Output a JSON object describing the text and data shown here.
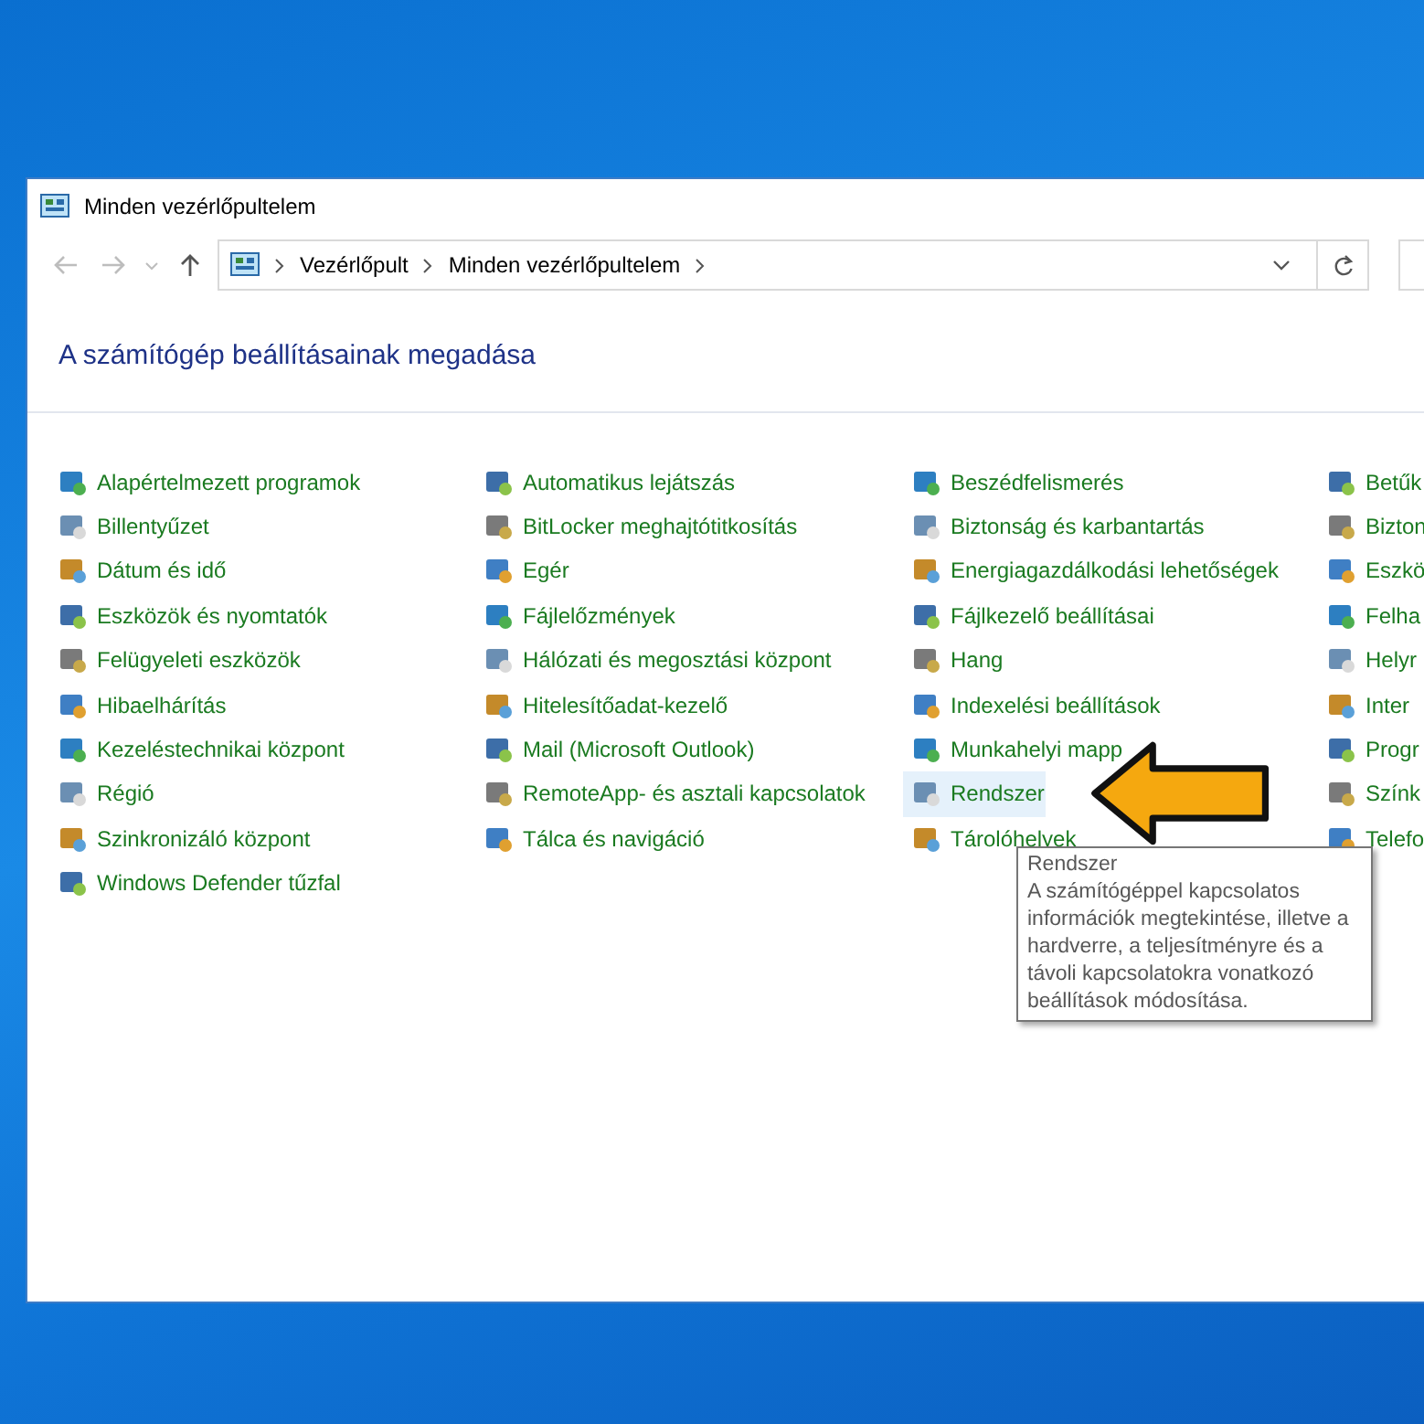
{
  "window": {
    "title": "Minden vezérlőpultelem"
  },
  "navigation": {
    "breadcrumbs": [
      "Vezérlőpult",
      "Minden vezérlőpultelem"
    ]
  },
  "heading": "A számítógép beállításainak megadása",
  "columns": [
    {
      "items": [
        {
          "label": "Alapértelmezett programok",
          "selected": false
        },
        {
          "label": "Billentyűzet",
          "selected": false
        },
        {
          "label": "Dátum és idő",
          "selected": false
        },
        {
          "label": "Eszközök és nyomtatók",
          "selected": false
        },
        {
          "label": "Felügyeleti eszközök",
          "selected": false
        },
        {
          "label": "Hibaelhárítás",
          "selected": false
        },
        {
          "label": "Kezeléstechnikai központ",
          "selected": false
        },
        {
          "label": "Régió",
          "selected": false
        },
        {
          "label": "Szinkronizáló központ",
          "selected": false
        },
        {
          "label": "Windows Defender tűzfal",
          "selected": false
        }
      ]
    },
    {
      "items": [
        {
          "label": "Automatikus lejátszás",
          "selected": false
        },
        {
          "label": "BitLocker meghajtótitkosítás",
          "selected": false
        },
        {
          "label": "Egér",
          "selected": false
        },
        {
          "label": "Fájlelőzmények",
          "selected": false
        },
        {
          "label": "Hálózati és megosztási központ",
          "selected": false
        },
        {
          "label": "Hitelesítőadat-kezelő",
          "selected": false
        },
        {
          "label": "Mail (Microsoft Outlook)",
          "selected": false
        },
        {
          "label": "RemoteApp- és asztali kapcsolatok",
          "selected": false
        },
        {
          "label": "Tálca és navigáció",
          "selected": false
        }
      ]
    },
    {
      "items": [
        {
          "label": "Beszédfelismerés",
          "selected": false
        },
        {
          "label": "Biztonság és karbantartás",
          "selected": false
        },
        {
          "label": "Energiagazdálkodási lehetőségek",
          "selected": false
        },
        {
          "label": "Fájlkezelő beállításai",
          "selected": false
        },
        {
          "label": "Hang",
          "selected": false
        },
        {
          "label": "Indexelési beállítások",
          "selected": false
        },
        {
          "label": "Munkahelyi mapp",
          "selected": false
        },
        {
          "label": "Rendszer",
          "selected": true
        },
        {
          "label": "Tárolóhelyek",
          "selected": false
        }
      ]
    },
    {
      "items": [
        {
          "label": "Betűk",
          "selected": false
        },
        {
          "label": "Bizton",
          "selected": false
        },
        {
          "label": "Eszkö",
          "selected": false
        },
        {
          "label": "Felha",
          "selected": false
        },
        {
          "label": "Helyr",
          "selected": false
        },
        {
          "label": "Inter",
          "selected": false
        },
        {
          "label": "Progr",
          "selected": false
        },
        {
          "label": "Színk",
          "selected": false
        },
        {
          "label": "Telefo",
          "selected": false
        }
      ]
    }
  ],
  "tooltip": {
    "title": "Rendszer",
    "text": "A számítógéppel kapcsolatos információk megtekintése, illetve a hardverre, a teljesítményre és a távoli kapcsolatokra vonatkozó beállítások módosítása."
  }
}
